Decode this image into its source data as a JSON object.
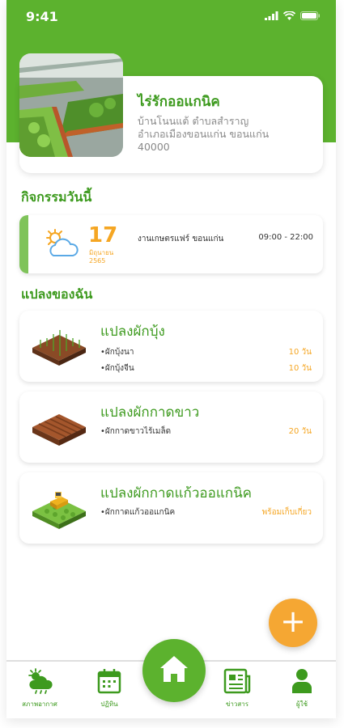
{
  "status_bar": {
    "time": "9:41"
  },
  "farm": {
    "name": "ไร่รักออแกนิค",
    "address_line1": "บ้านโนนแต้ ตำบลสำราญ",
    "address_line2": "อำเภอเมืองขอนแก่น ขอนแก่น",
    "address_line3": "40000"
  },
  "activities": {
    "title": "กิจกรรมวันนี้",
    "items": [
      {
        "day": "17",
        "month": "มิถุนายน",
        "year": "2565",
        "event": "งานเกษตรแฟร์ ขอนแก่น",
        "time": "09:00 - 22:00",
        "weather_icon": "partly-cloudy-icon"
      }
    ]
  },
  "plots": {
    "title": "แปลงของฉัน",
    "items": [
      {
        "name": "แปลงผักบุ้ง",
        "image": "seedling-plot-icon",
        "crops": [
          {
            "veg": "•ผักบุ้งนา",
            "status": "10 วัน"
          },
          {
            "veg": "•ผักบุ้งจีน",
            "status": "10 วัน"
          }
        ]
      },
      {
        "name": "แปลงผักกาดขาว",
        "image": "soil-plot-icon",
        "crops": [
          {
            "veg": "•ผักกาดขาวไร้เมล็ด",
            "status": "20 วัน"
          }
        ]
      },
      {
        "name": "แปลงผักกาดแก้วออแกนิค",
        "image": "harvester-plot-icon",
        "crops": [
          {
            "veg": "•ผักกาดแก้วออแกนิค",
            "status": "พร้อมเก็บเกี่ยว"
          }
        ]
      }
    ]
  },
  "fab": {
    "label": "+"
  },
  "bottom_nav": {
    "items": [
      {
        "label": "สภาพอากาศ",
        "icon": "weather-icon"
      },
      {
        "label": "ปฏิทิน",
        "icon": "calendar-icon"
      },
      {
        "label": "",
        "icon": "home-icon"
      },
      {
        "label": "ข่าวสาร",
        "icon": "news-icon"
      },
      {
        "label": "ผู้ใช้",
        "icon": "user-icon"
      }
    ]
  },
  "colors": {
    "primary": "#5cb22e",
    "primary_text": "#3d9a1e",
    "accent": "#f5a623"
  }
}
